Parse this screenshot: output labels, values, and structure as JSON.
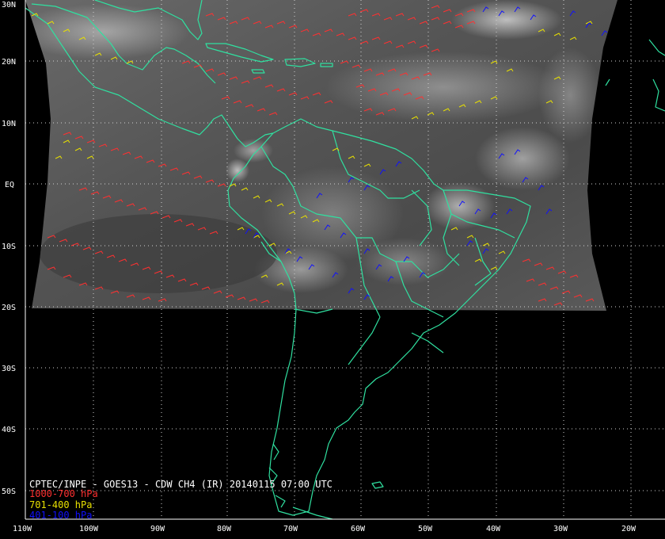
{
  "product": {
    "title": "CPTEC/INPE - GOES13 - CDW CH4 (IR) 20140115 07:00 UTC"
  },
  "legend": [
    {
      "label": "1000-700 hPa",
      "color": "#ff3030"
    },
    {
      "label": "701-400 hPa",
      "color": "#e8e000"
    },
    {
      "label": "401-100 hPa",
      "color": "#1010ff"
    }
  ],
  "grid": {
    "lat_labels": [
      "30N",
      "20N",
      "10N",
      "EQ",
      "10S",
      "20S",
      "30S",
      "40S",
      "50S"
    ],
    "lon_labels": [
      "110W",
      "100W",
      "90W",
      "80W",
      "70W",
      "60W",
      "50W",
      "40W",
      "30W",
      "20W"
    ]
  },
  "colors": {
    "coastline": "#30e0a0",
    "grid": "#d0d0d0",
    "background": "#000000"
  }
}
